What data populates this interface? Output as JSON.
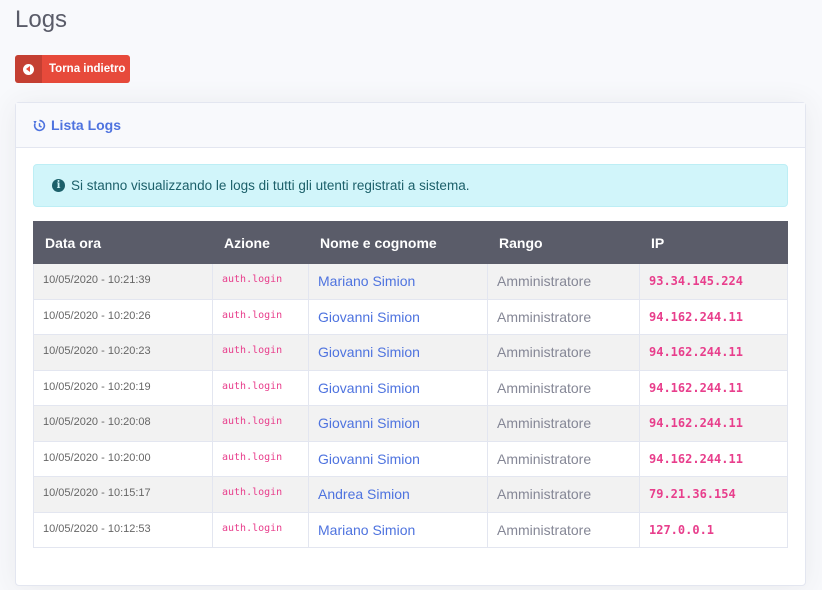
{
  "page": {
    "title": "Logs"
  },
  "back_button": {
    "label": "Torna indietro",
    "icon": "arrow-circle-left-icon"
  },
  "card": {
    "header_title": "Lista Logs",
    "header_icon": "history-icon",
    "alert_text": "Si stanno visualizzando le logs di tutti gli utenti registrati a sistema.",
    "alert_icon": "info-circle-icon"
  },
  "table": {
    "columns": [
      "Data ora",
      "Azione",
      "Nome e cognome",
      "Rango",
      "IP"
    ],
    "rows": [
      [
        "10/05/2020 - 10:21:39",
        "auth.login",
        "Mariano Simion",
        "Amministratore",
        "93.34.145.224"
      ],
      [
        "10/05/2020 - 10:20:26",
        "auth.login",
        "Giovanni Simion",
        "Amministratore",
        "94.162.244.11"
      ],
      [
        "10/05/2020 - 10:20:23",
        "auth.login",
        "Giovanni Simion",
        "Amministratore",
        "94.162.244.11"
      ],
      [
        "10/05/2020 - 10:20:19",
        "auth.login",
        "Giovanni Simion",
        "Amministratore",
        "94.162.244.11"
      ],
      [
        "10/05/2020 - 10:20:08",
        "auth.login",
        "Giovanni Simion",
        "Amministratore",
        "94.162.244.11"
      ],
      [
        "10/05/2020 - 10:20:00",
        "auth.login",
        "Giovanni Simion",
        "Amministratore",
        "94.162.244.11"
      ],
      [
        "10/05/2020 - 10:15:17",
        "auth.login",
        "Andrea Simion",
        "Amministratore",
        "79.21.36.154"
      ],
      [
        "10/05/2020 - 10:12:53",
        "auth.login",
        "Mariano Simion",
        "Amministratore",
        "127.0.0.1"
      ]
    ]
  },
  "colors": {
    "danger": "#e74a3b",
    "primary": "#4e73df",
    "code": "#e83e8c",
    "header_bg": "#5a5c69",
    "alert_bg": "#d1f5fa"
  }
}
